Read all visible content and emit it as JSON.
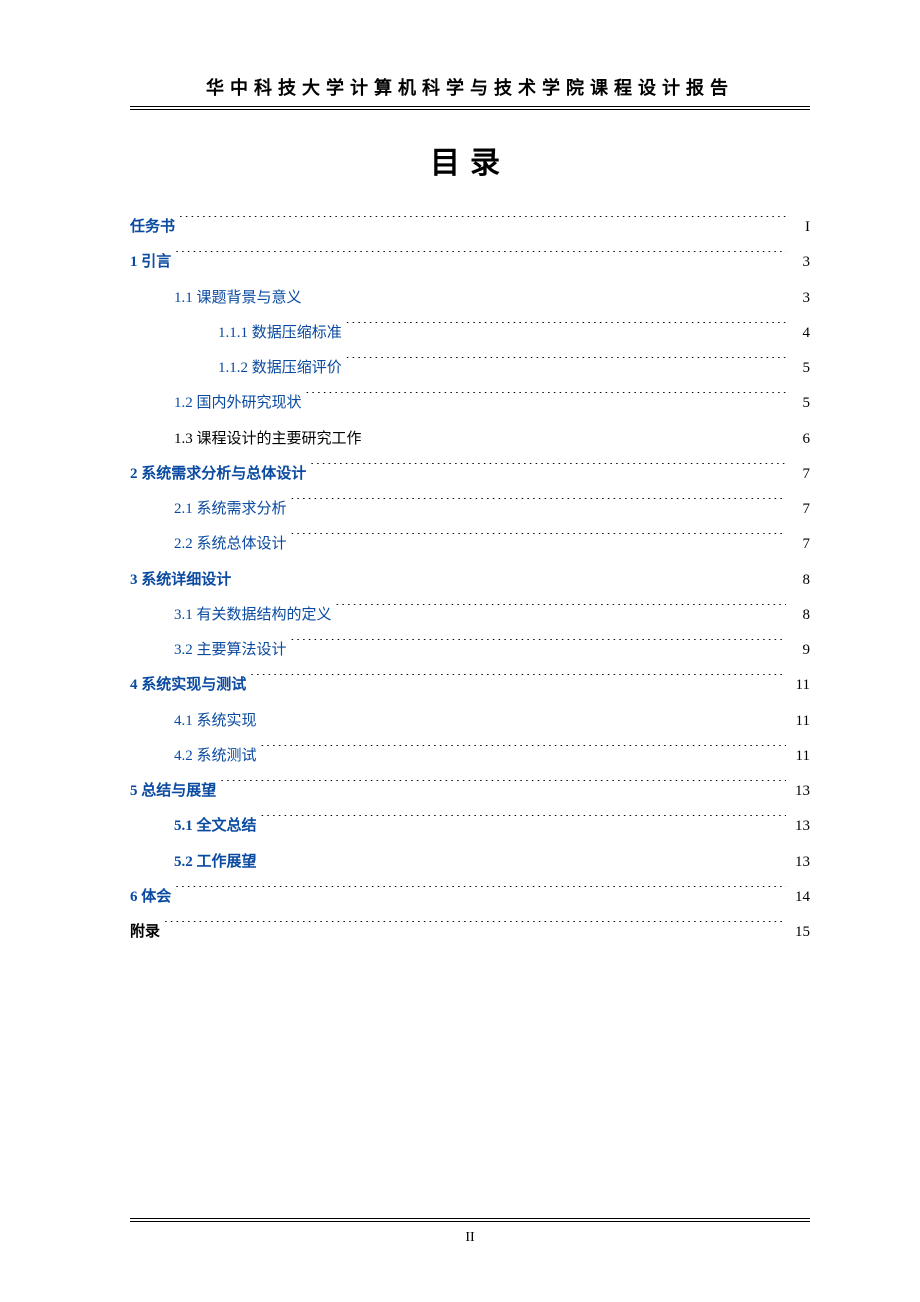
{
  "header": "华中科技大学计算机科学与技术学院课程设计报告",
  "title": "目录",
  "footer_page": "II",
  "toc": [
    {
      "level": 1,
      "label": "任务书",
      "page": "I",
      "bold": true,
      "plain": false
    },
    {
      "level": 1,
      "label": "1 引言",
      "page": "3",
      "bold": true,
      "plain": false
    },
    {
      "level": 2,
      "label": "1.1 课题背景与意义",
      "page": "3",
      "bold": false,
      "plain": false
    },
    {
      "level": 3,
      "label": "1.1.1 数据压缩标准",
      "page": "4",
      "bold": false,
      "plain": false
    },
    {
      "level": 3,
      "label": "1.1.2 数据压缩评价",
      "page": "5",
      "bold": false,
      "plain": false
    },
    {
      "level": 2,
      "label": "1.2 国内外研究现状",
      "page": "5",
      "bold": false,
      "plain": false
    },
    {
      "level": 2,
      "label": "1.3 课程设计的主要研究工作",
      "page": "6",
      "bold": false,
      "plain": true
    },
    {
      "level": 1,
      "label": "2 系统需求分析与总体设计",
      "page": "7",
      "bold": true,
      "plain": false
    },
    {
      "level": 2,
      "label": "2.1 系统需求分析",
      "page": "7",
      "bold": false,
      "plain": false
    },
    {
      "level": 2,
      "label": "2.2 系统总体设计",
      "page": "7",
      "bold": false,
      "plain": false
    },
    {
      "level": 1,
      "label": "3 系统详细设计",
      "page": "8",
      "bold": true,
      "plain": false
    },
    {
      "level": 2,
      "label": "3.1 有关数据结构的定义",
      "page": "8",
      "bold": false,
      "plain": false
    },
    {
      "level": 2,
      "label": "3.2 主要算法设计",
      "page": "9",
      "bold": false,
      "plain": false
    },
    {
      "level": 1,
      "label": "4 系统实现与测试",
      "page": "11",
      "bold": true,
      "plain": false
    },
    {
      "level": 2,
      "label": "4.1 系统实现",
      "page": "11",
      "bold": false,
      "plain": false
    },
    {
      "level": 2,
      "label": "4.2 系统测试",
      "page": "11",
      "bold": false,
      "plain": false
    },
    {
      "level": 1,
      "label": "5 总结与展望",
      "page": "13",
      "bold": true,
      "plain": false
    },
    {
      "level": 2,
      "label": "5.1 全文总结",
      "page": "13",
      "bold": true,
      "plain": false
    },
    {
      "level": 2,
      "label": "5.2 工作展望",
      "page": "13",
      "bold": true,
      "plain": false
    },
    {
      "level": 1,
      "label": "6 体会",
      "page": "14",
      "bold": true,
      "plain": false
    },
    {
      "level": 1,
      "label": "附录",
      "page": "15",
      "bold": true,
      "plain": true
    }
  ]
}
